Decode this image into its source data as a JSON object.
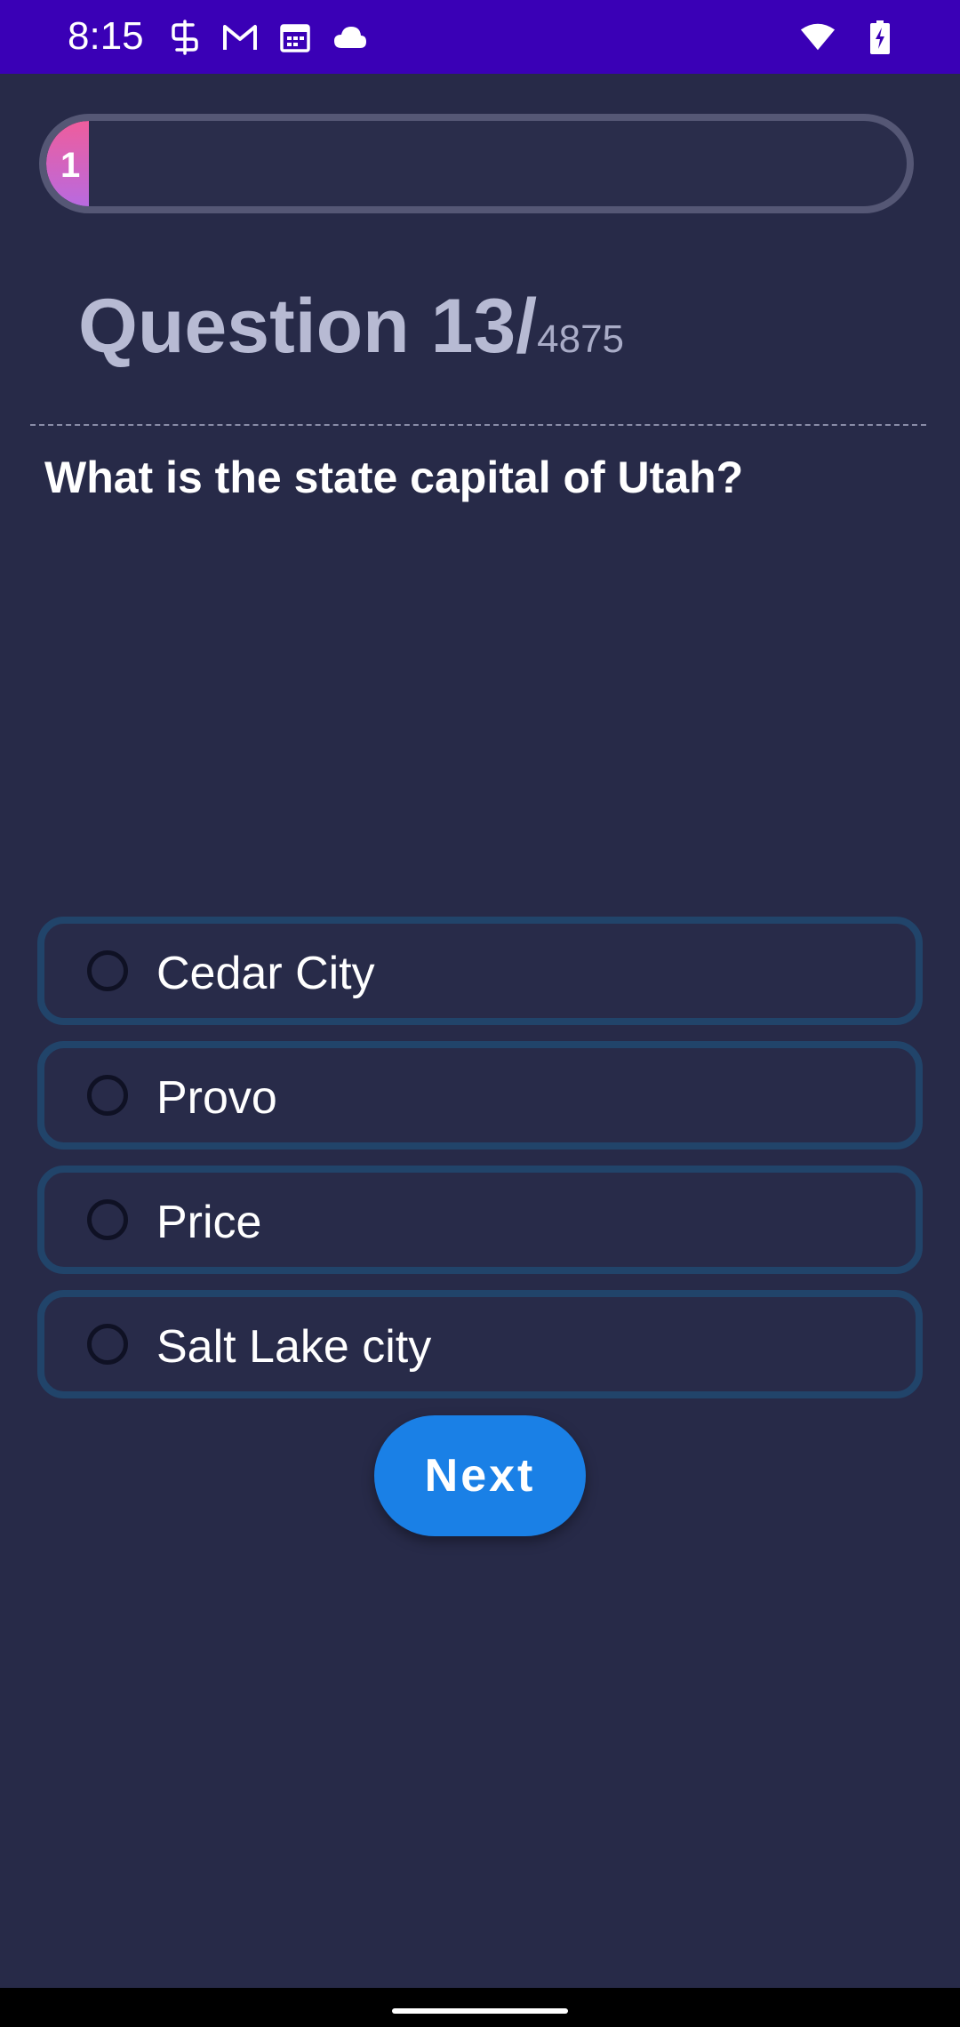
{
  "status_bar": {
    "time": "8:15",
    "left_icons": [
      "sim-icon",
      "gmail-icon",
      "calendar-icon",
      "cloud-icon"
    ],
    "right_icons": [
      "wifi-icon",
      "battery-charging-icon"
    ],
    "background": "#3a00b6"
  },
  "progress": {
    "label": "1",
    "fraction": 0.05
  },
  "question": {
    "counter_prefix": "Question 13/",
    "counter_total": "4875",
    "text": "What is the state capital of Utah?"
  },
  "options": [
    {
      "label": "Cedar City",
      "selected": false
    },
    {
      "label": "Provo",
      "selected": false
    },
    {
      "label": "Price",
      "selected": false
    },
    {
      "label": "Salt Lake city",
      "selected": false
    }
  ],
  "next_button": {
    "label": "Next",
    "color": "#1a80e6"
  },
  "theme": {
    "background": "#272a48",
    "option_border": "#21446a",
    "progress_gradient": [
      "#ef5d9c",
      "#b86ae0"
    ]
  }
}
